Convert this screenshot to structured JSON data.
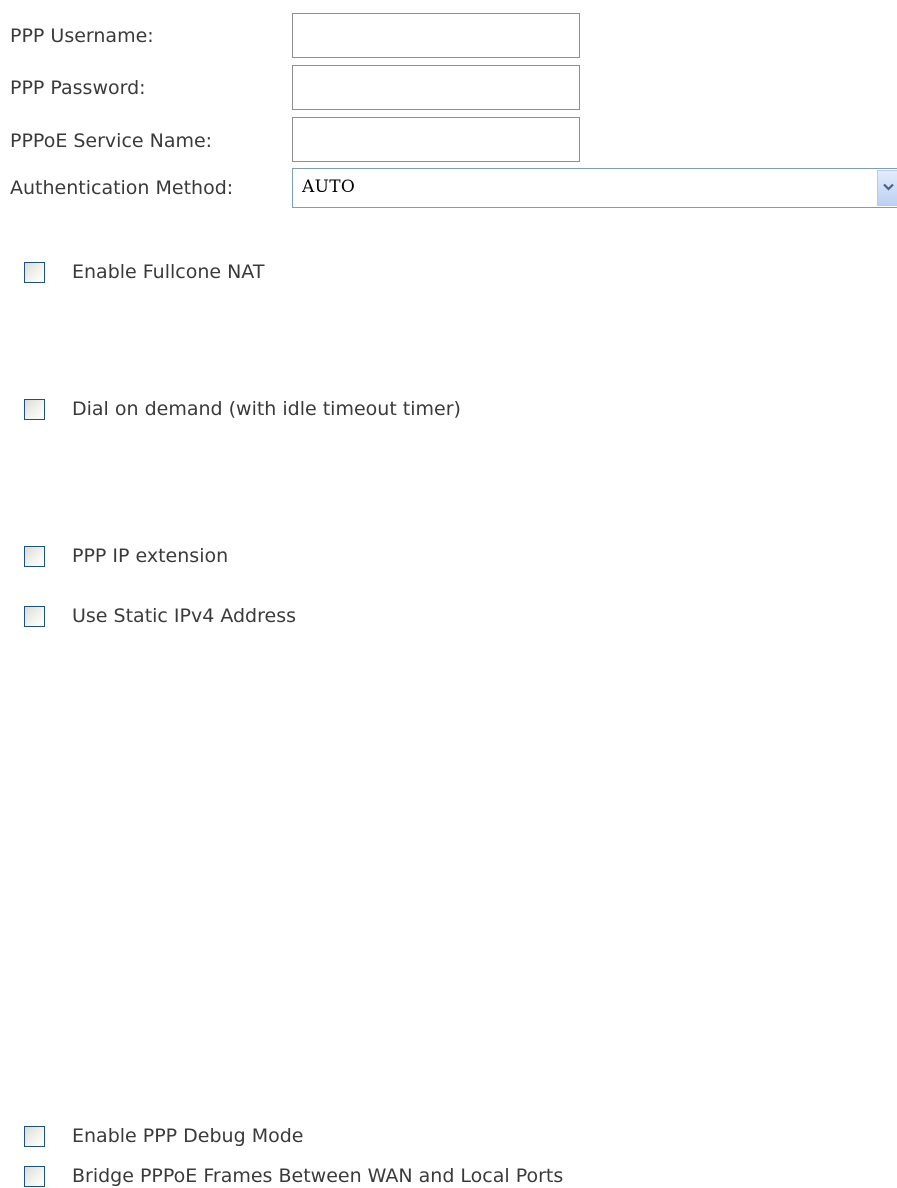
{
  "ppp_settings": {
    "username": {
      "label": "PPP Username:",
      "value": ""
    },
    "password": {
      "label": "PPP Password:",
      "value": ""
    },
    "service_name": {
      "label": "PPPoE Service Name:",
      "value": ""
    },
    "auth_method": {
      "label": "Authentication Method:",
      "selected": "AUTO"
    }
  },
  "options": {
    "fullcone_nat": {
      "label": "Enable Fullcone NAT",
      "checked": false
    },
    "dial_on_demand": {
      "label": "Dial on demand (with idle timeout timer)",
      "checked": false
    },
    "ppp_ip_extension": {
      "label": "PPP IP extension",
      "checked": false
    },
    "static_ipv4": {
      "label": "Use Static IPv4 Address",
      "checked": false
    },
    "ppp_debug": {
      "label": "Enable PPP Debug Mode",
      "checked": false
    },
    "bridge_pppoe": {
      "label": "Bridge PPPoE Frames Between WAN and Local Ports",
      "checked": false
    }
  }
}
